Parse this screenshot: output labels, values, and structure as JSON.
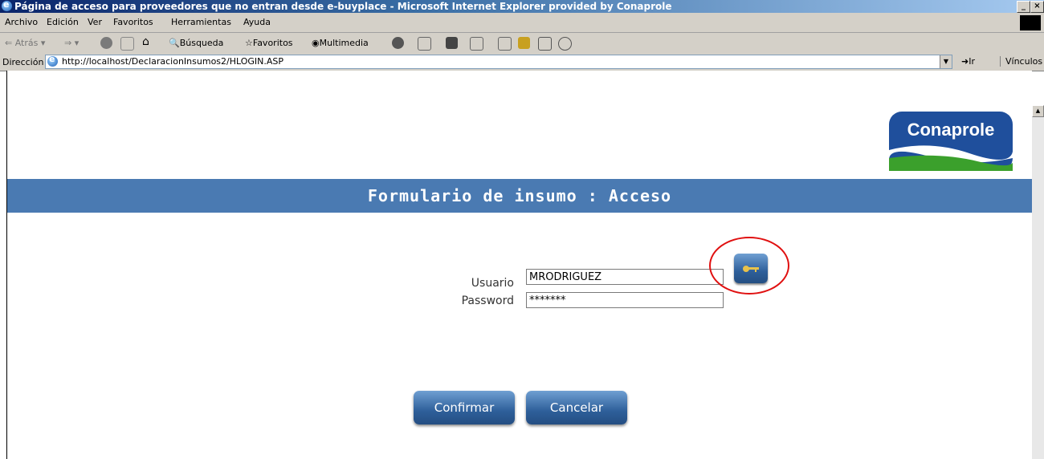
{
  "window": {
    "title": "Página de acceso para proveedores que no entran desde e-buyplace - Microsoft Internet Explorer provided by Conaprole",
    "controls": [
      "_",
      "×"
    ]
  },
  "menu": [
    "Archivo",
    "Edición",
    "Ver",
    "Favoritos",
    "Herramientas",
    "Ayuda"
  ],
  "toolbar": {
    "back": "Atrás",
    "search": "Búsqueda",
    "favorites": "Favoritos",
    "media": "Multimedia"
  },
  "address": {
    "label": "Dirección",
    "url": "http://localhost/DeclaracionInsumos2/HLOGIN.ASP",
    "go": "Ir",
    "links": "Vínculos"
  },
  "page": {
    "logo_text": "Conaprole",
    "banner": "Formulario de insumo : Acceso",
    "user_label": "Usuario",
    "user_value": "MRODRIGUEZ",
    "password_label": "Password",
    "password_value": "*******",
    "confirm": "Confirmar",
    "cancel": "Cancelar"
  },
  "colors": {
    "banner": "#4a7ab2",
    "button": "#2e5f9a",
    "highlight": "#e01010",
    "logo": "#1f4f9c"
  }
}
